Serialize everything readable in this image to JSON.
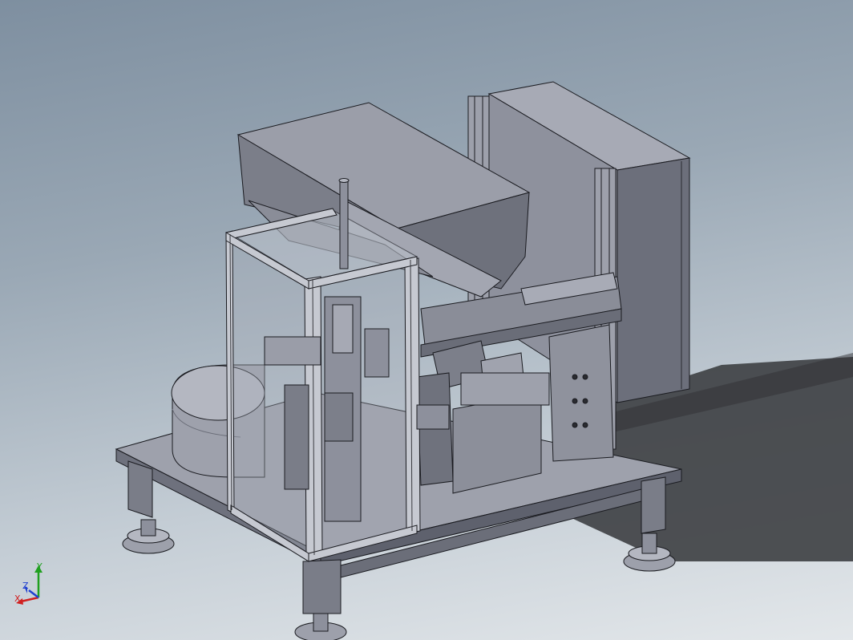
{
  "window": {
    "view": "isometric-3d-model"
  },
  "model": {
    "components": [
      {
        "name": "base-plate"
      },
      {
        "name": "leveling-feet"
      },
      {
        "name": "hopper"
      },
      {
        "name": "electrical-cabinet"
      },
      {
        "name": "aluminum-profile-enclosure"
      },
      {
        "name": "round-tank"
      },
      {
        "name": "feed-track"
      },
      {
        "name": "pneumatic-cylinder"
      },
      {
        "name": "vertical-rod"
      }
    ]
  },
  "triad": {
    "x_label": "X",
    "y_label": "Y",
    "z_label": "Z",
    "x_color": "#d02020",
    "y_color": "#20a020",
    "z_color": "#2040d0"
  },
  "colors": {
    "part": "#8d909c",
    "part_dark": "#5b5e6b",
    "part_light": "#b4b7c1",
    "edge": "#1a1b20",
    "shadow": "#3d3f42"
  }
}
